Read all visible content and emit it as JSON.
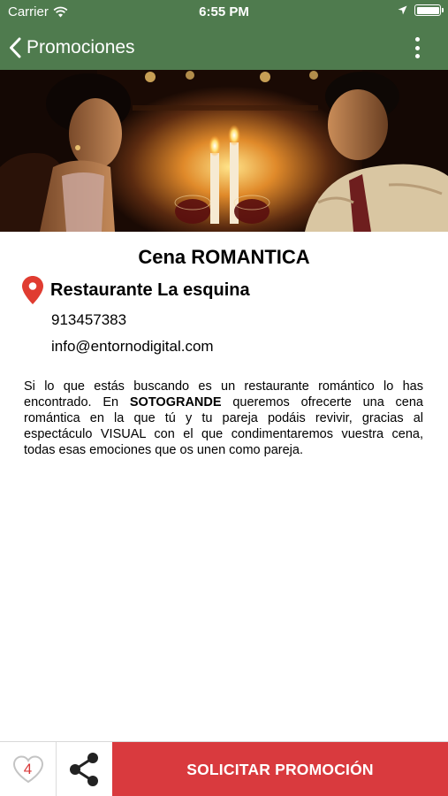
{
  "status_bar": {
    "carrier": "Carrier",
    "time": "6:55 PM"
  },
  "nav": {
    "back_label": "Promociones",
    "more_icon": "more-vertical-icon"
  },
  "colors": {
    "nav_background": "#4f7b4e",
    "primary_button": "#d93a3e",
    "pin": "#e03c31"
  },
  "promotion": {
    "title": "Cena ROMANTICA",
    "restaurant": "Restaurante La esquina",
    "phone": "913457383",
    "email": "info@entornodigital.com",
    "description": {
      "before": "Si lo que estás buscando es un restaurante romántico  lo has encontrado. En ",
      "highlight": "SOTOGRANDE",
      "after": " queremos ofrecerte una cena romántica en la que tú y tu pareja podáis revivir, gracias al espectáculo VISUAL con el que condimentaremos vuestra cena, todas esas emociones que os unen como pareja."
    }
  },
  "bottom_bar": {
    "like_count": "4",
    "request_button": "SOLICITAR PROMOCIÓN"
  }
}
